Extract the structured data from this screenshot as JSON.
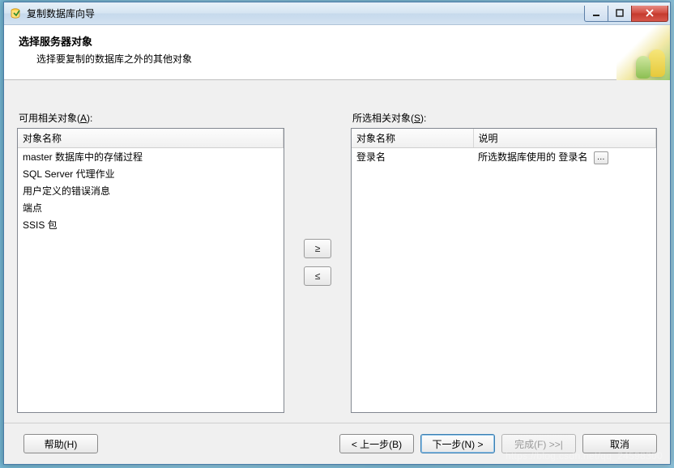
{
  "window": {
    "title": "复制数据库向导"
  },
  "header": {
    "title": "选择服务器对象",
    "subtitle": "选择要复制的数据库之外的其他对象"
  },
  "available": {
    "caption_prefix": "可用相关对象(",
    "caption_accel": "A",
    "caption_suffix": "):",
    "columns": [
      "对象名称"
    ],
    "items": [
      "master 数据库中的存储过程",
      "SQL Server 代理作业",
      "用户定义的错误消息",
      "端点",
      "SSIS 包"
    ]
  },
  "selected": {
    "caption_prefix": "所选相关对象(",
    "caption_accel": "S",
    "caption_suffix": "):",
    "columns": [
      "对象名称",
      "说明"
    ],
    "rows": [
      {
        "name": "登录名",
        "desc": "所选数据库使用的 登录名"
      }
    ]
  },
  "move": {
    "add": "≥",
    "remove": "≤"
  },
  "footer": {
    "help": "帮助(H)",
    "back": "< 上一步(B)",
    "next": "下一步(N) >",
    "finish": "完成(F) >>|",
    "cancel": "取消"
  },
  "watermark": "https://blog.csdn.net/qq_24598300"
}
